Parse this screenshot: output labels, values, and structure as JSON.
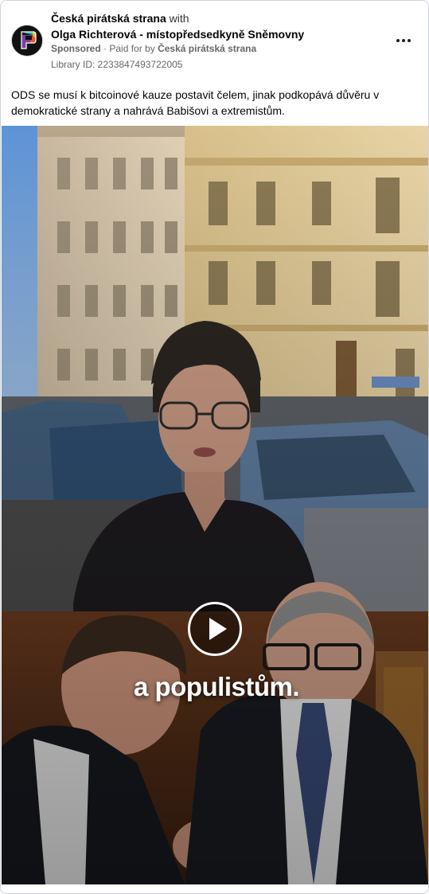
{
  "post": {
    "page_name": "Česká pirátská strana",
    "with_text": "with",
    "coauthor": "Olga Richterová - místopředsedkyně Sněmovny",
    "sponsored_label": "Sponsored",
    "separator": "·",
    "paid_prefix": "Paid for by",
    "payer": "Česká pirátská strana",
    "library_id": "Library ID: 2233847493722005",
    "text": "ODS se musí k bitcoinové kauze postavit čelem, jinak podkopává důvěru v demokratické strany a nahrává Babišovi a extremistům."
  },
  "video": {
    "caption": "a populistům."
  },
  "icons": {
    "avatar": "pirate-party-logo",
    "more": "more-options-icon",
    "play": "play-icon"
  },
  "colors": {
    "card_border": "#d0d3d8",
    "text_primary": "#050505",
    "text_secondary": "#65676b"
  }
}
